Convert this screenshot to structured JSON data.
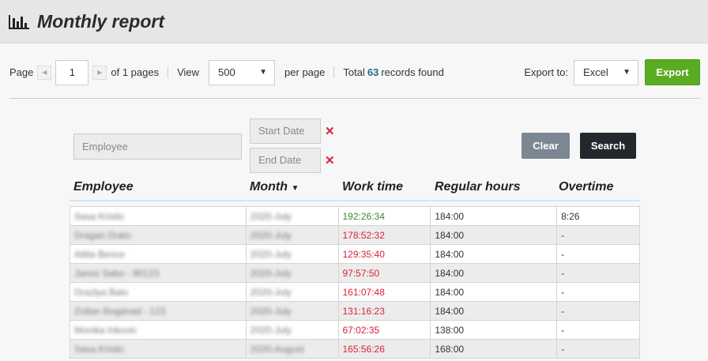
{
  "header": {
    "title": "Monthly report",
    "icon": "bar-chart-icon"
  },
  "toolbar": {
    "page_label": "Page",
    "page_value": "1",
    "of_pages": "of 1 pages",
    "view_label": "View",
    "view_value": "500",
    "per_page": "per page",
    "total_prefix": "Total",
    "total_count": "63",
    "total_suffix": "records found",
    "export_to_label": "Export to:",
    "export_format": "Excel",
    "export_button": "Export"
  },
  "filters": {
    "employee_placeholder": "Employee",
    "start_date_placeholder": "Start Date",
    "end_date_placeholder": "End Date",
    "clear_button": "Clear",
    "search_button": "Search"
  },
  "columns": {
    "employee": "Employee",
    "month": "Month",
    "work_time": "Work time",
    "regular_hours": "Regular hours",
    "overtime": "Overtime"
  },
  "colors": {
    "accent": "#5aac22",
    "under_time": "#d9223b",
    "over_time": "#3a8a2a"
  },
  "rows": [
    {
      "employee": "Sasa Kristic",
      "month": "2020-July",
      "work_time": "192:26:34",
      "regular_hours": "184:00",
      "overtime": "8:26"
    },
    {
      "employee": "Dragan Dukic",
      "month": "2020-July",
      "work_time": "178:52:32",
      "regular_hours": "184:00",
      "overtime": "-"
    },
    {
      "employee": "Attila Bence",
      "month": "2020-July",
      "work_time": "129:35:40",
      "regular_hours": "184:00",
      "overtime": "-"
    },
    {
      "employee": "Janos Sabo - 90123",
      "month": "2020-July",
      "work_time": "97:57:50",
      "regular_hours": "184:00",
      "overtime": "-"
    },
    {
      "employee": "Drazlya Balo",
      "month": "2020-July",
      "work_time": "161:07:48",
      "regular_hours": "184:00",
      "overtime": "-"
    },
    {
      "employee": "Zoltan Bogdnad - 123",
      "month": "2020-July",
      "work_time": "131:16:23",
      "regular_hours": "184:00",
      "overtime": "-"
    },
    {
      "employee": "Monika Inkovic",
      "month": "2020-July",
      "work_time": "67:02:35",
      "regular_hours": "138:00",
      "overtime": "-"
    },
    {
      "employee": "Sasa Kristic",
      "month": "2020-August",
      "work_time": "165:56:26",
      "regular_hours": "168:00",
      "overtime": "-"
    }
  ]
}
